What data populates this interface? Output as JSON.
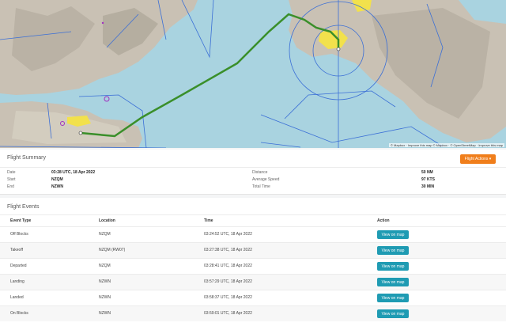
{
  "map": {
    "attribution": "© Mapbox · Improve this map    © Mapbox · © OpenStreetMap · Improve this map"
  },
  "summary": {
    "title": "Flight Summary",
    "actions_label": "Flight Actions ▾",
    "date_label": "Date",
    "date_value": "03:28 UTC, 18 Apr 2022",
    "start_label": "Start",
    "start_value": "NZQM",
    "end_label": "End",
    "end_value": "NZWN",
    "distance_label": "Distance",
    "distance_value": "50 NM",
    "speed_label": "Average Speed",
    "speed_value": "97 KTS",
    "time_label": "Total Time",
    "time_value": "30 MIN"
  },
  "events": {
    "title": "Flight Events",
    "columns": [
      "Event Type",
      "Location",
      "Time",
      "Action"
    ],
    "rows": [
      {
        "type": "Off Blocks",
        "location": "NZQM",
        "time": "03:24:52 UTC, 18 Apr 2022",
        "action": "View on map"
      },
      {
        "type": "Takeoff",
        "location": "NZQM (RW07)",
        "time": "03:27:38 UTC, 18 Apr 2022",
        "action": "View on map"
      },
      {
        "type": "Departed",
        "location": "NZQM",
        "time": "03:28:41 UTC, 18 Apr 2022",
        "action": "View on map"
      },
      {
        "type": "Landing",
        "location": "NZWN",
        "time": "03:57:29 UTC, 18 Apr 2022",
        "action": "View on map"
      },
      {
        "type": "Landed",
        "location": "NZWN",
        "time": "03:58:37 UTC, 18 Apr 2022",
        "action": "View on map"
      },
      {
        "type": "On Blocks",
        "location": "NZWN",
        "time": "03:59:01 UTC, 18 Apr 2022",
        "action": "View on map"
      }
    ]
  }
}
